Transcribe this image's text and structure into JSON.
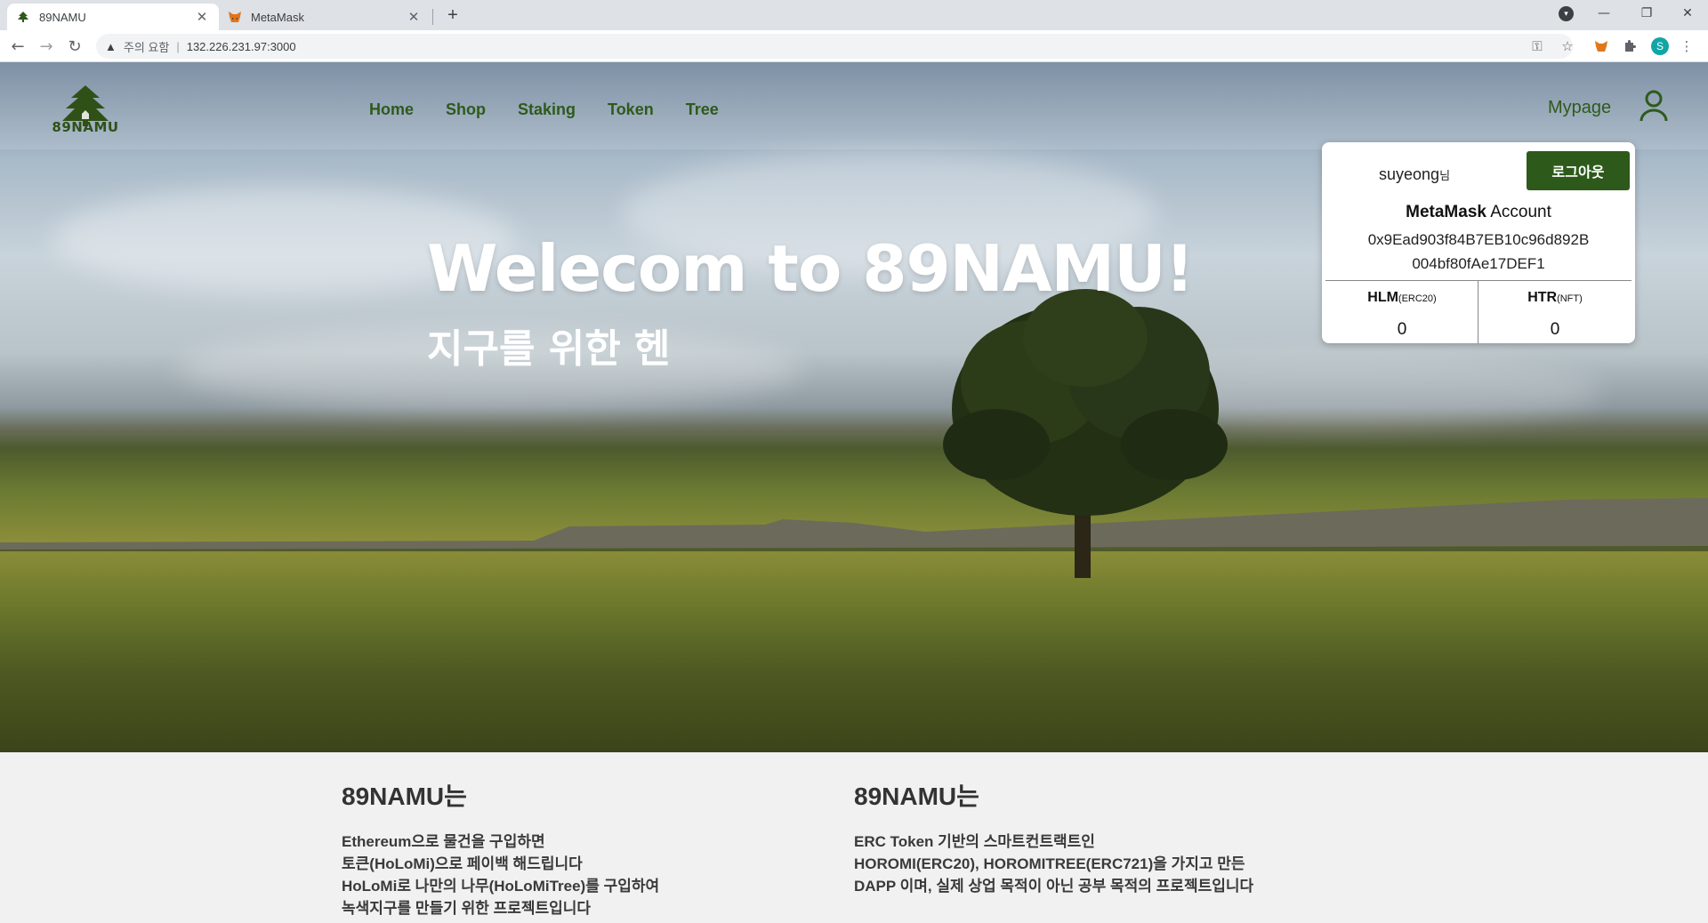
{
  "browser": {
    "tabs": [
      {
        "title": "89NAMU",
        "active": true
      },
      {
        "title": "MetaMask",
        "active": false
      }
    ],
    "address": {
      "security_label": "주의 요함",
      "separator": "|",
      "url": "132.226.231.97:3000"
    },
    "profile_initial": "S"
  },
  "site": {
    "logo_text": "89NAMU",
    "nav": [
      "Home",
      "Shop",
      "Staking",
      "Token",
      "Tree"
    ],
    "mypage_label": "Mypage"
  },
  "hero": {
    "title": "Welecom to 89NAMU!",
    "subtitle": "지구를 위한 헨"
  },
  "account_popup": {
    "username": "suyeong",
    "username_suffix": "님",
    "logout_label": "로그아웃",
    "metamask_bold": "MetaMask",
    "metamask_rest": " Account",
    "address_line1": "0x9Ead903f84B7EB10c96d892B",
    "address_line2": "004bf80fAe17DEF1",
    "tokens": [
      {
        "name": "HLM",
        "type": "(ERC20)",
        "balance": "0"
      },
      {
        "name": "HTR",
        "type": "(NFT)",
        "balance": "0"
      }
    ]
  },
  "info": [
    {
      "heading": "89NAMU는",
      "lines": [
        "Ethereum으로 물건을 구입하면",
        "토큰(HoLoMi)으로 페이백 해드립니다",
        "HoLoMi로 나만의 나무(HoLoMiTree)를 구입하여",
        "녹색지구를 만들기 위한 프로젝트입니다"
      ]
    },
    {
      "heading": "89NAMU는",
      "lines": [
        "ERC Token 기반의 스마트컨트랙트인",
        "HOROMI(ERC20), HOROMITREE(ERC721)을 가지고 만든",
        "DAPP 이며, 실제 상업 목적이 아닌 공부 목적의 프로젝트입니다"
      ]
    }
  ],
  "colors": {
    "brand_green": "#2e5a1b",
    "button_green": "#2d5a1b"
  }
}
